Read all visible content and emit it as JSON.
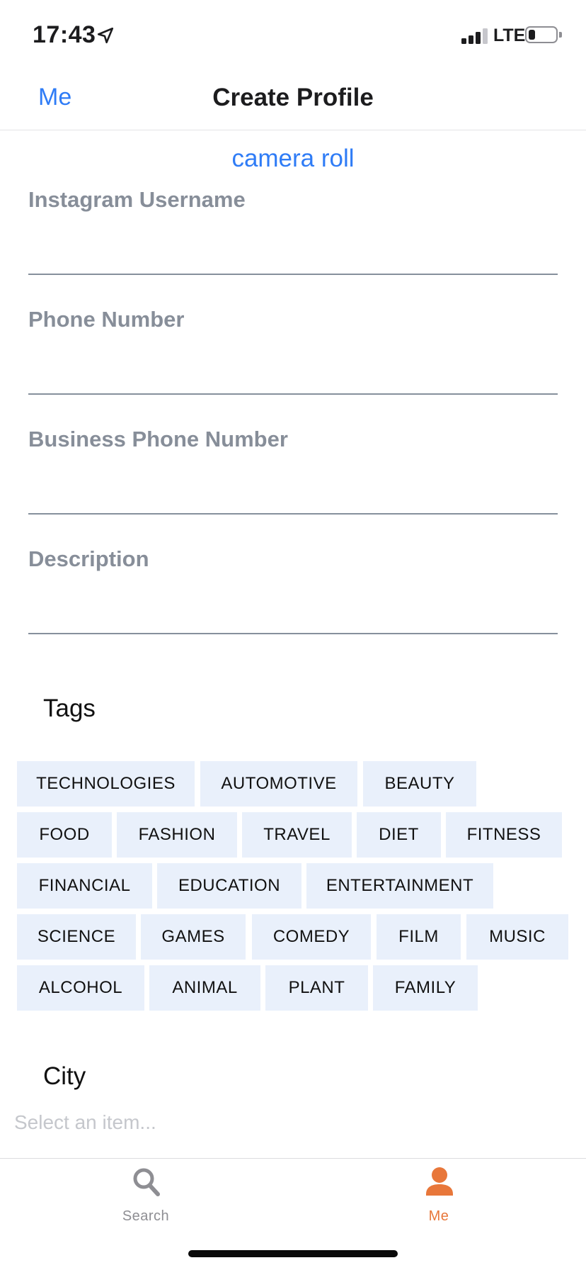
{
  "status_bar": {
    "time": "17:43",
    "network": "LTE",
    "battery_level": 0.25
  },
  "nav": {
    "back_label": "Me",
    "title": "Create Profile"
  },
  "camera_roll_label": "camera roll",
  "fields": [
    {
      "label": "Instagram Username",
      "value": ""
    },
    {
      "label": "Phone Number",
      "value": ""
    },
    {
      "label": "Business Phone Number",
      "value": ""
    },
    {
      "label": "Description",
      "value": ""
    }
  ],
  "tags_title": "Tags",
  "tags": [
    "TECHNOLOGIES",
    "AUTOMOTIVE",
    "BEAUTY",
    "FOOD",
    "FASHION",
    "TRAVEL",
    "DIET",
    "FITNESS",
    "FINANCIAL",
    "EDUCATION",
    "ENTERTAINMENT",
    "SCIENCE",
    "GAMES",
    "COMEDY",
    "FILM",
    "MUSIC",
    "ALCOHOL",
    "ANIMAL",
    "PLANT",
    "FAMILY"
  ],
  "city": {
    "title": "City",
    "placeholder": "Select an item..."
  },
  "tab_bar": {
    "tabs": [
      {
        "label": "Search",
        "icon": "search-icon",
        "active": false
      },
      {
        "label": "Me",
        "icon": "person-icon",
        "active": true
      }
    ],
    "active_color": "#e8773a",
    "inactive_color": "#8e8e93"
  },
  "colors": {
    "accent": "#2f7cf6",
    "tag_bg": "#e9f0fb",
    "label_gray": "#878e99"
  }
}
